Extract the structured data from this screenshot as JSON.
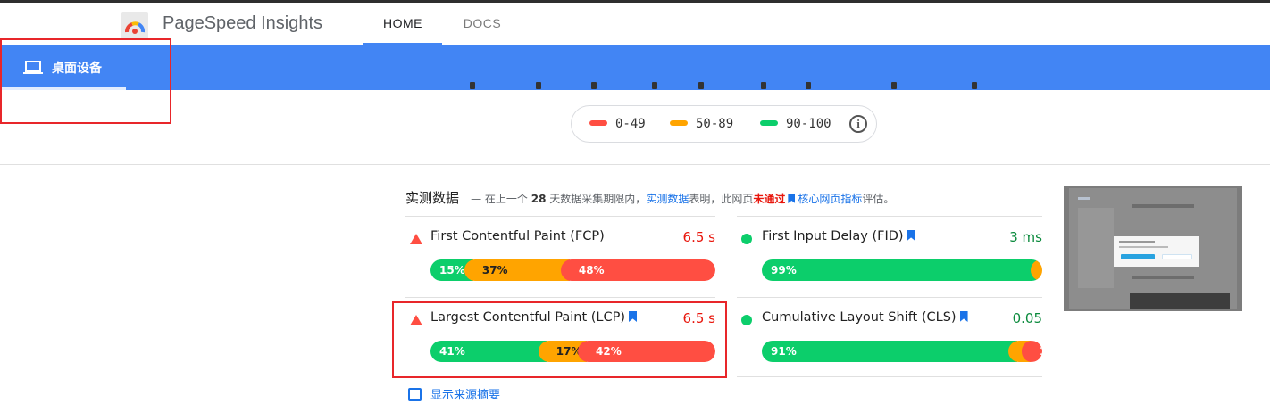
{
  "app": {
    "title": "PageSpeed Insights"
  },
  "nav": {
    "tabs": [
      "HOME",
      "DOCS"
    ]
  },
  "device_tab": {
    "label": "桌面设备",
    "icon": "laptop-icon"
  },
  "legend": {
    "poor": "0-49",
    "average": "50-89",
    "good": "90-100",
    "info_icon": "info-icon"
  },
  "colors": {
    "accent": "#4285f4",
    "good": "#0cce6b",
    "average": "#ffa400",
    "poor": "#ff4e42",
    "link": "#1a73e8"
  },
  "field_data": {
    "title": "实测数据",
    "desc_1": "— 在上一个",
    "desc_days": "28",
    "desc_2": "天数据采集期限内，",
    "desc_link": "实测数据",
    "desc_3": "表明，此网页",
    "desc_fail": "未通过",
    "desc_link2": "核心网页指标",
    "desc_4": "评估。",
    "metrics": [
      {
        "name": "First Contentful Paint (FCP)",
        "value": "6.5 s",
        "status": "poor",
        "bookmark": false,
        "dist": {
          "good": "15%",
          "avg": "37%",
          "poor": "48%"
        }
      },
      {
        "name": "First Input Delay (FID)",
        "value": "3 ms",
        "status": "good",
        "bookmark": true,
        "dist": {
          "good": "99%",
          "avg": "1%",
          "poor": ""
        }
      },
      {
        "name": "Largest Contentful Paint (LCP)",
        "value": "6.5 s",
        "status": "poor",
        "bookmark": true,
        "dist": {
          "good": "41%",
          "avg": "17%",
          "poor": "42%"
        }
      },
      {
        "name": "Cumulative Layout Shift (CLS)",
        "value": "0.05",
        "status": "good",
        "bookmark": true,
        "dist": {
          "good": "91%",
          "avg": "8%",
          "poor": "1%"
        }
      }
    ]
  },
  "origin_summary": {
    "label": "显示来源摘要"
  }
}
